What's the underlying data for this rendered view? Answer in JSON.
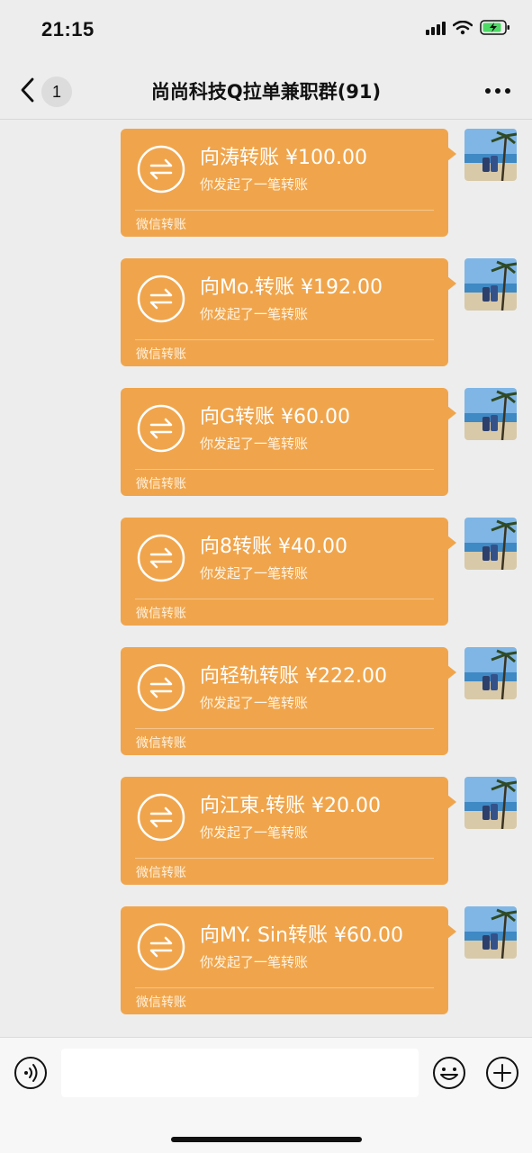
{
  "status_bar": {
    "time": "21:15"
  },
  "header": {
    "unread_count": "1",
    "title": "尚尚科技Q拉单兼职群(91)"
  },
  "messages": [
    {
      "title": "向涛转账 ¥100.00",
      "subtitle": "你发起了一笔转账",
      "footer": "微信转账"
    },
    {
      "title": "向Mo.转账 ¥192.00",
      "subtitle": "你发起了一笔转账",
      "footer": "微信转账"
    },
    {
      "title": "向G转账 ¥60.00",
      "subtitle": "你发起了一笔转账",
      "footer": "微信转账"
    },
    {
      "title": "向8转账 ¥40.00",
      "subtitle": "你发起了一笔转账",
      "footer": "微信转账"
    },
    {
      "title": "向轻轨转账 ¥222.00",
      "subtitle": "你发起了一笔转账",
      "footer": "微信转账"
    },
    {
      "title": "向江東.转账 ¥20.00",
      "subtitle": "你发起了一笔转账",
      "footer": "微信转账"
    },
    {
      "title": "向MY. Sin转账 ¥60.00",
      "subtitle": "你发起了一笔转账",
      "footer": "微信转账"
    }
  ],
  "input": {
    "value": ""
  },
  "colors": {
    "transfer_bubble": "#f0a54c",
    "background": "#ededed"
  },
  "icons": [
    "back-arrow-icon",
    "more-icon",
    "transfer-icon",
    "voice-icon",
    "emoji-icon",
    "plus-icon",
    "wifi-icon",
    "battery-icon",
    "signal-icon"
  ]
}
